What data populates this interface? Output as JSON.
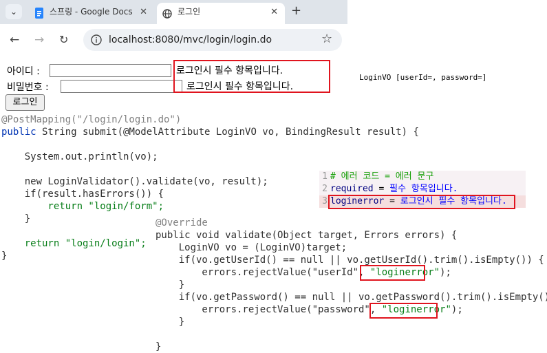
{
  "browser": {
    "tabs": [
      {
        "label": "스프링 - Google Docs"
      },
      {
        "label": "로그인"
      }
    ],
    "url": "localhost:8080/mvc/login/login.do"
  },
  "form": {
    "id_label": "아이디 :",
    "pw_label": "비밀번호 :",
    "id_error": "로그인시 필수 항목입니다.",
    "pw_error": "로그인시 필수 항목입니다.",
    "submit_label": "로그인"
  },
  "console_output": "LoginVO [userId=, password=]",
  "props": [
    {
      "num": "1",
      "text": "# 에러 코드 = 에러 문구"
    },
    {
      "num": "2",
      "key": "required",
      "eq": " = ",
      "val": "필수 항목입니다."
    },
    {
      "num": "3",
      "key": "loginerror",
      "eq": " = ",
      "val": "로그인시 필수 항목입니다."
    }
  ],
  "code_controller": {
    "l1": "@PostMapping(\"/login/login.do\")",
    "l2_kw": "public",
    "l2_rest": " String submit(@ModelAttribute LoginVO vo, BindingResult result) {",
    "l3": "    System.out.println(vo);",
    "l4": "    new LoginValidator().validate(vo, result);",
    "l5": "    if(result.hasErrors()) {",
    "l6": "        return \"login/form\";",
    "l7": "    }",
    "l8": "    return \"login/login\";",
    "l9": "}"
  },
  "code_validator": {
    "l1": "@Override",
    "l2": "public void validate(Object target, Errors errors) {",
    "l3": "    LoginVO vo = (LoginVO)target;",
    "l4": "    if(vo.getUserId() == null || vo.getUserId().trim().isEmpty()) {",
    "l5a": "        errors.rejectValue(\"userId\", ",
    "l5b": "\"loginerror\"",
    "l5c": ");",
    "l6": "    }",
    "l7": "    if(vo.getPassword() == null || vo.getPassword().trim().isEmpty()) {",
    "l8a": "        errors.rejectValue(\"password\", ",
    "l8b": "\"loginerror\"",
    "l8c": ");",
    "l9": "    }",
    "l10": "}"
  }
}
